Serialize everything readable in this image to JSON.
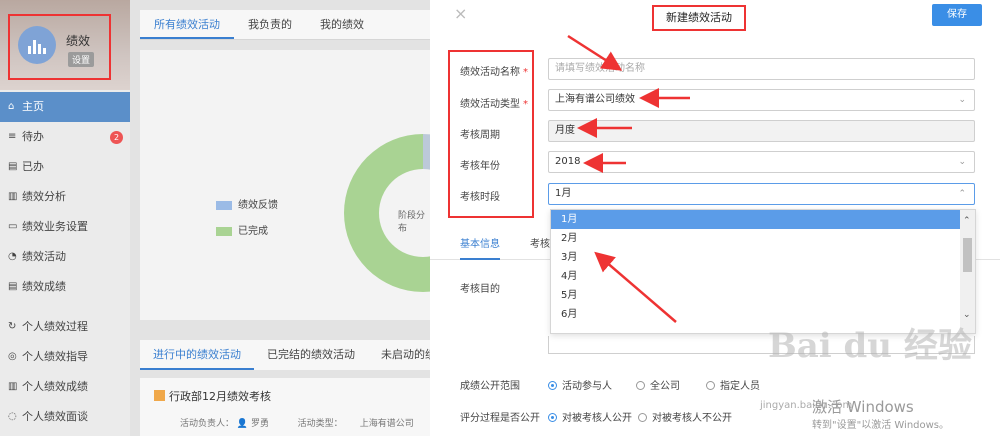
{
  "sidebar": {
    "app_name": "绩效",
    "settings_label": "设置",
    "items": [
      {
        "label": "主页",
        "icon": "home-icon",
        "glyph": "⌂",
        "active": true
      },
      {
        "label": "待办",
        "icon": "todo-icon",
        "glyph": "≡",
        "badge": "2"
      },
      {
        "label": "已办",
        "icon": "done-icon",
        "glyph": "▤"
      },
      {
        "label": "绩效分析",
        "icon": "analysis-icon",
        "glyph": "▥"
      },
      {
        "label": "绩效业务设置",
        "icon": "settings-icon",
        "glyph": "▭"
      },
      {
        "label": "绩效活动",
        "icon": "activity-icon",
        "glyph": "◔"
      },
      {
        "label": "绩效成绩",
        "icon": "score-icon",
        "glyph": "▤"
      },
      {
        "label": "个人绩效过程",
        "icon": "process-icon",
        "glyph": "↻"
      },
      {
        "label": "个人绩效指导",
        "icon": "guide-icon",
        "glyph": "◎"
      },
      {
        "label": "个人绩效成绩",
        "icon": "personal-score-icon",
        "glyph": "▥"
      },
      {
        "label": "个人绩效面谈",
        "icon": "interview-icon",
        "glyph": "◌"
      }
    ]
  },
  "content": {
    "tabs": [
      "所有绩效活动",
      "我负责的",
      "我的绩效"
    ],
    "legend": [
      {
        "label": "绩效反馈",
        "color": "#9bbbe6"
      },
      {
        "label": "已完成",
        "color": "#a9d393"
      }
    ],
    "donut_label": "阶段分布",
    "tabs2": [
      "进行中的绩效活动",
      "已完结的绩效活动",
      "未启动的绩"
    ],
    "card": {
      "title": "行政部12月绩效考核",
      "owner_label": "活动负责人：",
      "owner": "罗勇",
      "type_label": "活动类型：",
      "type": "上海有谱公司"
    }
  },
  "modal": {
    "close": "×",
    "title": "新建绩效活动",
    "save_label": "保存",
    "fields": {
      "name_label": "绩效活动名称",
      "name_placeholder": "请填写绩效活动名称",
      "type_label": "绩效活动类型",
      "type_value": "上海有谱公司绩效",
      "period_label": "考核周期",
      "period_value": "月度",
      "year_label": "考核年份",
      "year_value": "2018",
      "segment_label": "考核时段",
      "segment_value": "1月"
    },
    "tabs": [
      "基本信息",
      "考核"
    ],
    "goal_label": "考核目的",
    "dropdown_options": [
      "1月",
      "2月",
      "3月",
      "4月",
      "5月",
      "6月"
    ],
    "visibility": {
      "label": "成绩公开范围",
      "options": [
        "活动参与人",
        "全公司",
        "指定人员"
      ]
    },
    "evaluation": {
      "label": "评分过程是否公开",
      "options": [
        "对被考核人公开",
        "对被考核人不公开"
      ]
    },
    "watermark": "Bai du 经验",
    "watermark_sub": "jingyan.baidu.com",
    "activation_title": "激活 Windows",
    "activation_sub": "转到\"设置\"以激活 Windows。"
  }
}
